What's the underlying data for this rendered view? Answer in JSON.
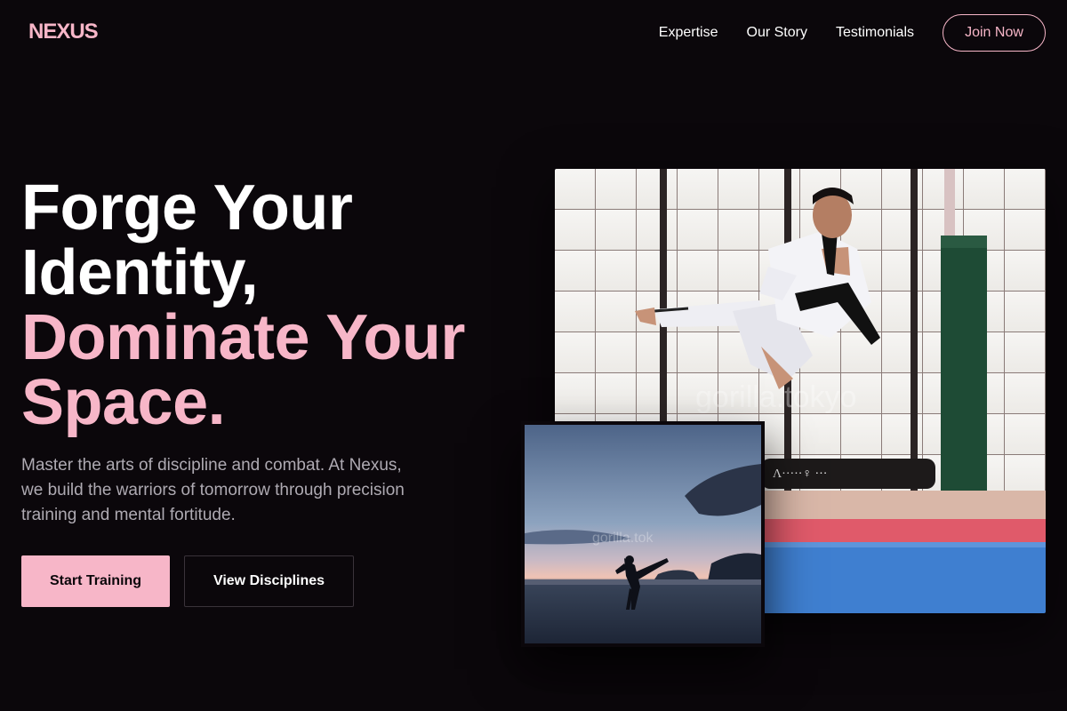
{
  "brand": {
    "logo": "NEXUS",
    "accent_color": "#f7b6c8",
    "background_color": "#0b070b"
  },
  "nav": {
    "links": [
      "Expertise",
      "Our Story",
      "Testimonials"
    ],
    "cta": "Join Now"
  },
  "hero": {
    "headline_lines": [
      {
        "text": "Forge Your",
        "color": "white"
      },
      {
        "text": "Identity,",
        "color": "white"
      },
      {
        "text": "Dominate Your",
        "color": "pink"
      },
      {
        "text": "Space.",
        "color": "pink"
      }
    ],
    "subtext": "Master the arts of discipline and combat. At Nexus, we build the warriors of tomorrow through precision training and mental fortitude.",
    "primary_button": "Start Training",
    "secondary_button": "View Disciplines"
  },
  "images": {
    "main": {
      "watermark": "gorilla.tokyo",
      "banner_text": "Λ·····♀ ···"
    },
    "small": {
      "watermark": "gorilla.tok"
    }
  }
}
